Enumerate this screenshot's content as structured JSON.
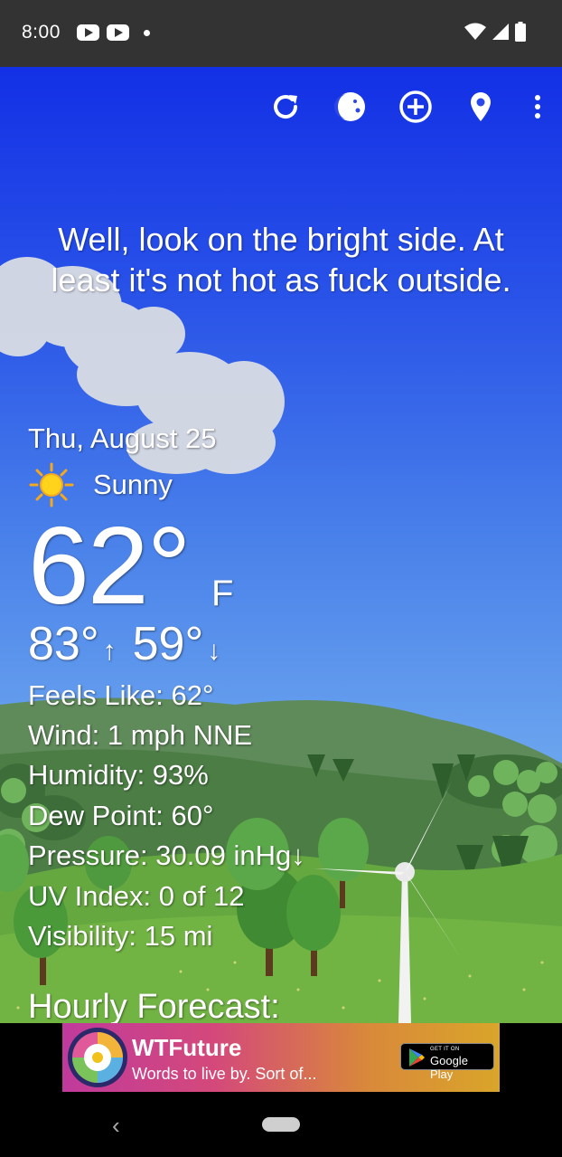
{
  "status_bar": {
    "time": "8:00",
    "icons": [
      "youtube-icon",
      "youtube-icon",
      "notification-dot-icon",
      "wifi-icon",
      "signal-icon",
      "battery-icon"
    ]
  },
  "toolbar": {
    "icons": [
      "refresh-icon",
      "moon-phase-icon",
      "add-icon",
      "location-pin-icon",
      "overflow-menu-icon"
    ]
  },
  "quote": "Well, look on the bright side. At least it's not hot as fuck outside.",
  "weather": {
    "date": "Thu, August 25",
    "condition": "Sunny",
    "condition_icon": "sun-icon",
    "temperature": "62°",
    "unit": "F",
    "high": "83°",
    "high_arrow": "↑",
    "low": "59°",
    "low_arrow": "↓",
    "details": [
      "Feels Like:  62°",
      "Wind:  1 mph NNE",
      "Humidity:  93%",
      "Dew Point:  60°",
      "Pressure:  30.09 inHg↓",
      "UV Index:  0 of 12",
      "Visibility:  15 mi"
    ],
    "hourly_heading": "Hourly Forecast:"
  },
  "ad": {
    "title": "WTFuture",
    "subtitle": "Words to live by.  Sort of...",
    "store_small": "GET IT ON",
    "store_big": "Google Play"
  },
  "colors": {
    "sky_top": "#1330e6",
    "sky_bottom": "#8fc1f2",
    "status_bar": "#333333",
    "ad_start": "#c03a9c",
    "ad_end": "#d9a52a"
  }
}
